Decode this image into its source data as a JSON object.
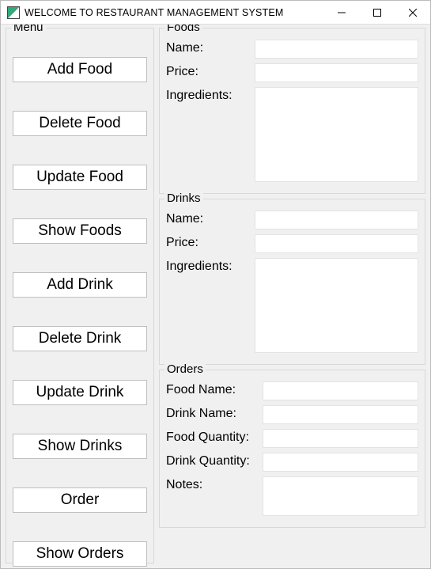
{
  "window": {
    "title": "WELCOME TO RESTAURANT MANAGEMENT SYSTEM"
  },
  "menu": {
    "legend": "Menu",
    "buttons": {
      "add_food": "Add Food",
      "delete_food": "Delete Food",
      "update_food": "Update Food",
      "show_foods": "Show Foods",
      "add_drink": "Add Drink",
      "delete_drink": "Delete Drink",
      "update_drink": "Update Drink",
      "show_drinks": "Show Drinks",
      "order": "Order",
      "show_orders": "Show Orders"
    }
  },
  "foods": {
    "legend": "Foods",
    "name_label": "Name:",
    "name_value": "",
    "price_label": "Price:",
    "price_value": "",
    "ingredients_label": "Ingredients:",
    "ingredients_value": ""
  },
  "drinks": {
    "legend": "Drinks",
    "name_label": "Name:",
    "name_value": "",
    "price_label": "Price:",
    "price_value": "",
    "ingredients_label": "Ingredients:",
    "ingredients_value": ""
  },
  "orders": {
    "legend": "Orders",
    "food_name_label": "Food Name:",
    "food_name_value": "",
    "drink_name_label": "Drink Name:",
    "drink_name_value": "",
    "food_qty_label": "Food Quantity:",
    "food_qty_value": "",
    "drink_qty_label": "Drink Quantity:",
    "drink_qty_value": "",
    "notes_label": "Notes:",
    "notes_value": ""
  }
}
